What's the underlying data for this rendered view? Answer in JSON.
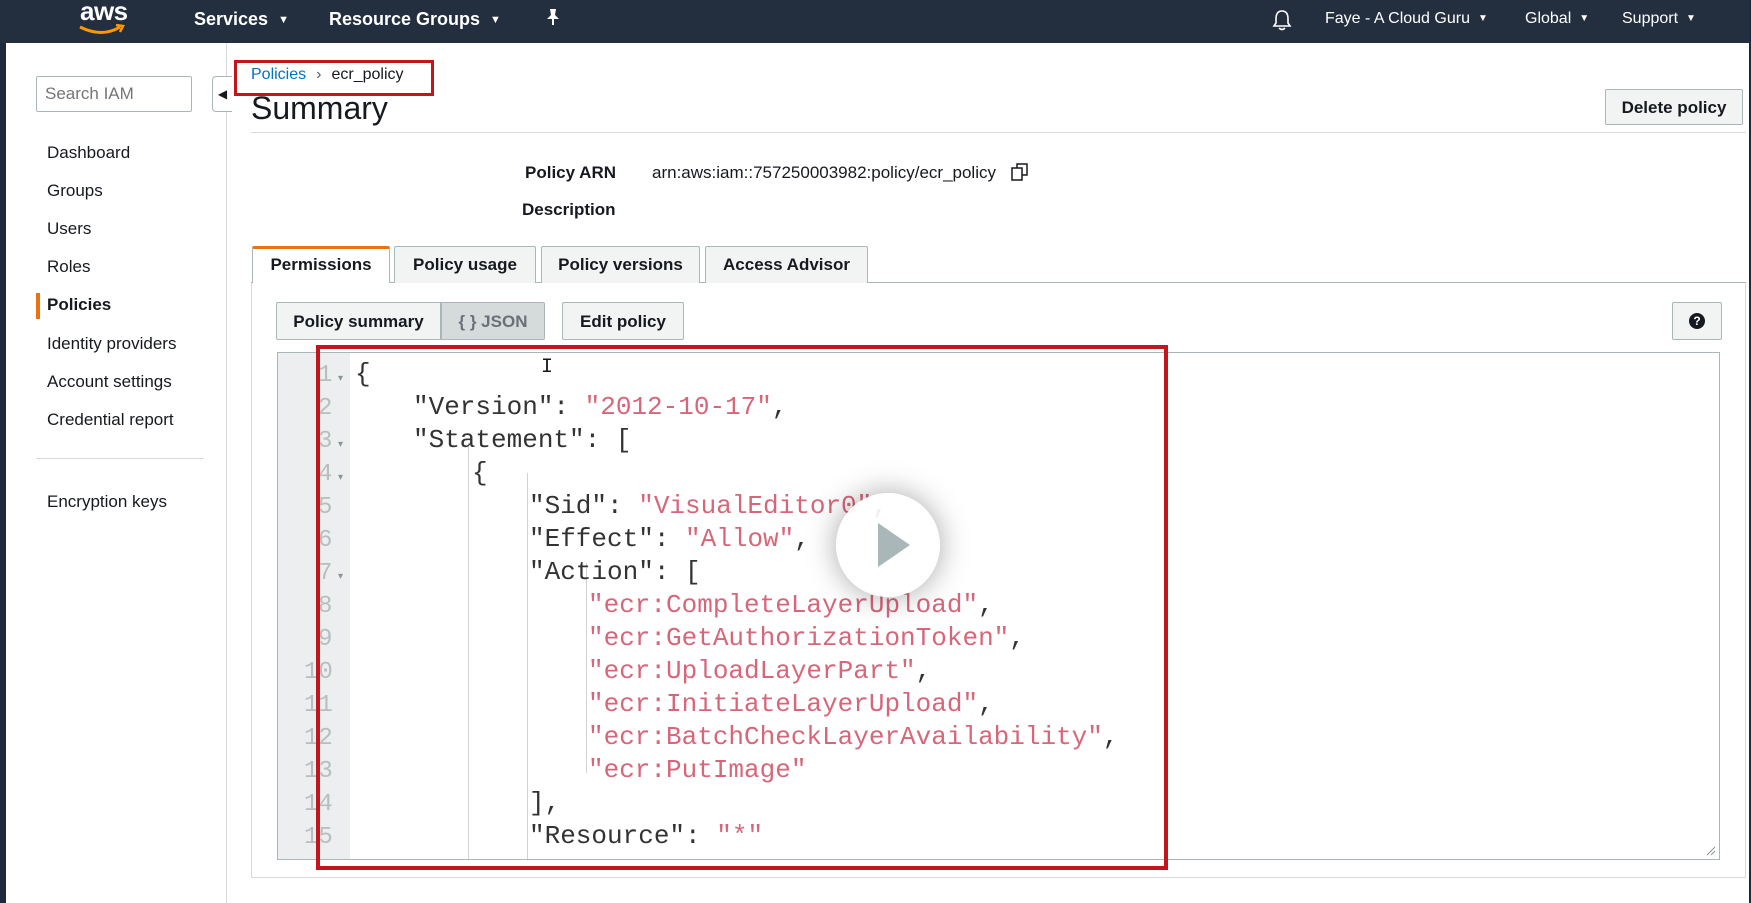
{
  "topnav": {
    "logo_text": "aws",
    "services": "Services",
    "resource_groups": "Resource Groups",
    "account": "Faye - A Cloud Guru",
    "region": "Global",
    "support": "Support"
  },
  "sidebar": {
    "search_placeholder": "Search IAM",
    "items": [
      {
        "label": "Dashboard"
      },
      {
        "label": "Groups"
      },
      {
        "label": "Users"
      },
      {
        "label": "Roles"
      },
      {
        "label": "Policies",
        "active": true
      },
      {
        "label": "Identity providers"
      },
      {
        "label": "Account settings"
      },
      {
        "label": "Credential report"
      }
    ],
    "secondary_items": [
      {
        "label": "Encryption keys"
      }
    ]
  },
  "breadcrumb": {
    "parent": "Policies",
    "current": "ecr_policy"
  },
  "page": {
    "title": "Summary",
    "delete_button": "Delete policy"
  },
  "meta": {
    "arn_label": "Policy ARN",
    "arn_value": "arn:aws:iam::757250003982:policy/ecr_policy",
    "description_label": "Description"
  },
  "tabs": [
    {
      "label": "Permissions",
      "active": true
    },
    {
      "label": "Policy usage"
    },
    {
      "label": "Policy versions"
    },
    {
      "label": "Access Advisor"
    }
  ],
  "toolbar": {
    "policy_summary": "Policy summary",
    "json": "{ } JSON",
    "edit_policy": "Edit policy",
    "help": "?"
  },
  "editor": {
    "line_numbers": [
      "1",
      "2",
      "3",
      "4",
      "5",
      "6",
      "7",
      "8",
      "9",
      "10",
      "11",
      "12",
      "13",
      "14",
      "15"
    ],
    "lines": {
      "l1": "{",
      "l2_key": "\"Version\": ",
      "l2_val": "\"2012-10-17\"",
      "l2_end": ",",
      "l3_key": "\"Statement\": [",
      "l4": "{",
      "l5_key": "\"Sid\": ",
      "l5_val": "\"VisualEditor0\"",
      "l5_end": ",",
      "l6_key": "\"Effect\": ",
      "l6_val": "\"Allow\"",
      "l6_end": ",",
      "l7_key": "\"Action\": [",
      "l8_val": "\"ecr:CompleteLayerUpload\"",
      "l8_end": ",",
      "l9_val": "\"ecr:GetAuthorizationToken\"",
      "l9_end": ",",
      "l10_val": "\"ecr:UploadLayerPart\"",
      "l10_end": ",",
      "l11_val": "\"ecr:InitiateLayerUpload\"",
      "l11_end": ",",
      "l12_val": "\"ecr:BatchCheckLayerAvailability\"",
      "l12_end": ",",
      "l13_val": "\"ecr:PutImage\"",
      "l14": "],",
      "l15_key": "\"Resource\": ",
      "l15_val": "\"*\""
    }
  },
  "colors": {
    "nav_bg": "#232f3e",
    "accent": "#ec7211",
    "link": "#0073bb",
    "highlight_box": "#c0161c",
    "json_string": "#d6677a"
  },
  "icons": {
    "pin": "pin-icon",
    "bell": "bell-icon",
    "copy": "copy-icon",
    "play": "play-icon"
  }
}
